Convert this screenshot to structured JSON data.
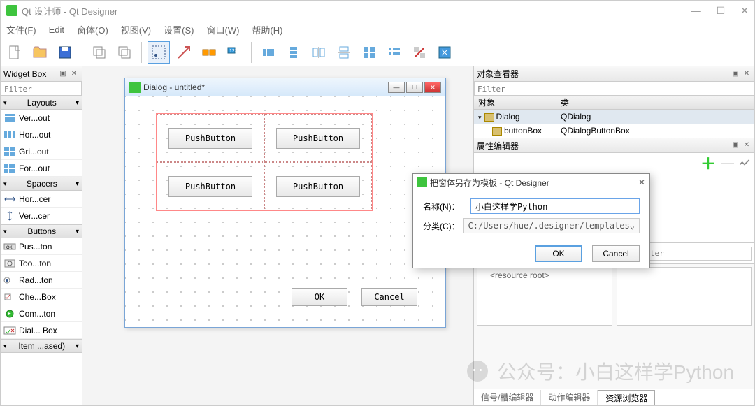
{
  "app": {
    "title": "Qt 设计师 - Qt Designer"
  },
  "menubar": {
    "file": "文件(F)",
    "edit": "Edit",
    "form": "窗体(O)",
    "view": "视图(V)",
    "settings": "设置(S)",
    "window": "窗口(W)",
    "help": "帮助(H)"
  },
  "widgetbox": {
    "title": "Widget Box",
    "filter_placeholder": "Filter",
    "categories": [
      {
        "name": "Layouts",
        "items": [
          {
            "label": "Ver...out"
          },
          {
            "label": "Hor...out"
          },
          {
            "label": "Gri...out"
          },
          {
            "label": "For...out"
          }
        ]
      },
      {
        "name": "Spacers",
        "items": [
          {
            "label": "Hor...cer"
          },
          {
            "label": "Ver...cer"
          }
        ]
      },
      {
        "name": "Buttons",
        "items": [
          {
            "label": "Pus...ton"
          },
          {
            "label": "Too...ton"
          },
          {
            "label": "Rad...ton"
          },
          {
            "label": "Che...Box"
          },
          {
            "label": "Com...ton"
          },
          {
            "label": "Dial... Box"
          }
        ]
      },
      {
        "name": "Item ...ased)",
        "items": []
      }
    ]
  },
  "design_window": {
    "title": "Dialog - untitled*",
    "push_button_label": "PushButton",
    "ok": "OK",
    "cancel": "Cancel"
  },
  "object_inspector": {
    "title": "对象查看器",
    "filter_placeholder": "Filter",
    "col_object": "对象",
    "col_class": "类",
    "rows": [
      {
        "name": "Dialog",
        "class": "QDialog",
        "indent": 0
      },
      {
        "name": "buttonBox",
        "class": "QDialogButtonBox",
        "indent": 1
      }
    ]
  },
  "property_editor": {
    "title": "属性编辑器"
  },
  "resource_editor": {
    "root": "<resource root>",
    "filter_placeholder": "Filter"
  },
  "bottom_tabs": {
    "signal_slot": "信号/槽编辑器",
    "action": "动作编辑器",
    "resource": "资源浏览器"
  },
  "modal": {
    "title": "把窗体另存为模板 - Qt Designer",
    "name_label": "名称(N)：",
    "name_value": "小白这样学Python",
    "category_label": "分类(C)：",
    "category_value": "C:/Users/***/.designer/templates",
    "ok": "OK",
    "cancel": "Cancel"
  },
  "watermark": "公众号：小白这样学Python"
}
